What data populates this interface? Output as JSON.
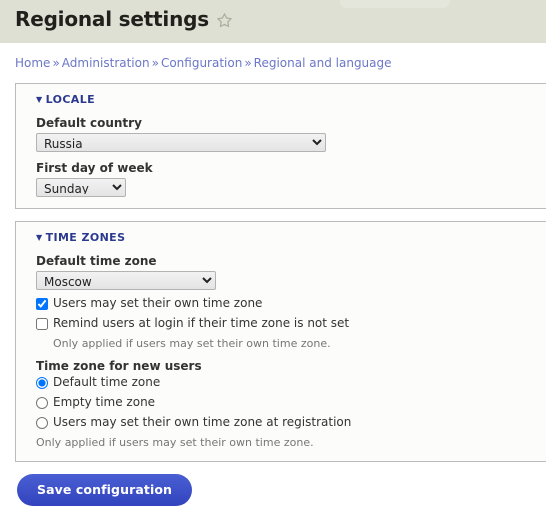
{
  "header": {
    "title": "Regional settings",
    "favorite_icon": "star-outline-icon",
    "band_color": "#dee0d4"
  },
  "breadcrumb": {
    "separator": "»",
    "items": [
      {
        "label": "Home"
      },
      {
        "label": "Administration"
      },
      {
        "label": "Configuration"
      },
      {
        "label": "Regional and language"
      }
    ],
    "link_color": "#6b77c7"
  },
  "sections": {
    "locale": {
      "legend": "LOCALE",
      "collapse_arrow": "▼",
      "country": {
        "label": "Default country",
        "value": "Russia",
        "options": [
          "Russia"
        ]
      },
      "first_day": {
        "label": "First day of week",
        "value": "Sunday",
        "options": [
          "Sunday"
        ]
      }
    },
    "time_zones": {
      "legend": "TIME ZONES",
      "collapse_arrow": "▼",
      "default_zone": {
        "label": "Default time zone",
        "value": "Moscow",
        "options": [
          "Moscow"
        ]
      },
      "users_may_set": {
        "label": "Users may set their own time zone",
        "checked": true
      },
      "remind_users": {
        "label": "Remind users at login if their time zone is not set",
        "checked": false,
        "description": "Only applied if users may set their own time zone."
      },
      "new_users": {
        "label": "Time zone for new users",
        "options": [
          {
            "label": "Default time zone",
            "selected": true
          },
          {
            "label": "Empty time zone",
            "selected": false
          },
          {
            "label": "Users may set their own time zone at registration",
            "selected": false
          }
        ],
        "description": "Only applied if users may set their own time zone."
      }
    }
  },
  "actions": {
    "save_label": "Save configuration",
    "save_color": "#3b50c8"
  }
}
